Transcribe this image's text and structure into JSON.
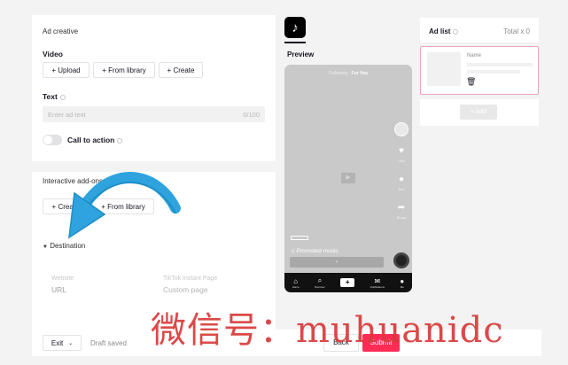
{
  "left": {
    "ad_creative_title": "Ad creative",
    "video_label": "Video",
    "video_buttons": [
      "+ Upload",
      "+ From library",
      "+ Create"
    ],
    "text_label": "Text",
    "text_placeholder": "Enter ad text",
    "text_counter": "0/100",
    "cta_label": "Call to action",
    "interactive_label": "Interactive add-ons",
    "interactive_buttons": [
      "+ Create",
      "+ From library"
    ],
    "destination_label": "Destination",
    "website_caption": "Website",
    "website_value": "URL",
    "instant_caption": "TikTok Instant Page",
    "instant_value": "Custom page"
  },
  "preview": {
    "logo": "♪",
    "label": "Preview",
    "top_following": "Following",
    "top_foryou": "For You",
    "like_count": "Like",
    "comment_count": "Text",
    "share_count": "Share",
    "music": "♫ Promoted music",
    "cta": "›",
    "nav": [
      {
        "icon": "⌂",
        "label": "Home"
      },
      {
        "icon": "⌕",
        "label": "Discover"
      },
      {
        "icon": "+",
        "label": ""
      },
      {
        "icon": "✉",
        "label": "Notifications"
      },
      {
        "icon": "●",
        "label": "Me"
      }
    ]
  },
  "adlist": {
    "title": "Ad list",
    "total": "Total x 0",
    "card_name": "Name",
    "trash_icon": "🗑",
    "add_label": "+ Add"
  },
  "bottom": {
    "exit": "Exit",
    "draft": "Draft saved",
    "back": "Back",
    "submit": "Submit"
  },
  "watermark": "微信号：muhuanidc",
  "colors": {
    "accent": "#fe2c55",
    "arrow": "#2ea3de",
    "watermark": "#d83a3a"
  }
}
